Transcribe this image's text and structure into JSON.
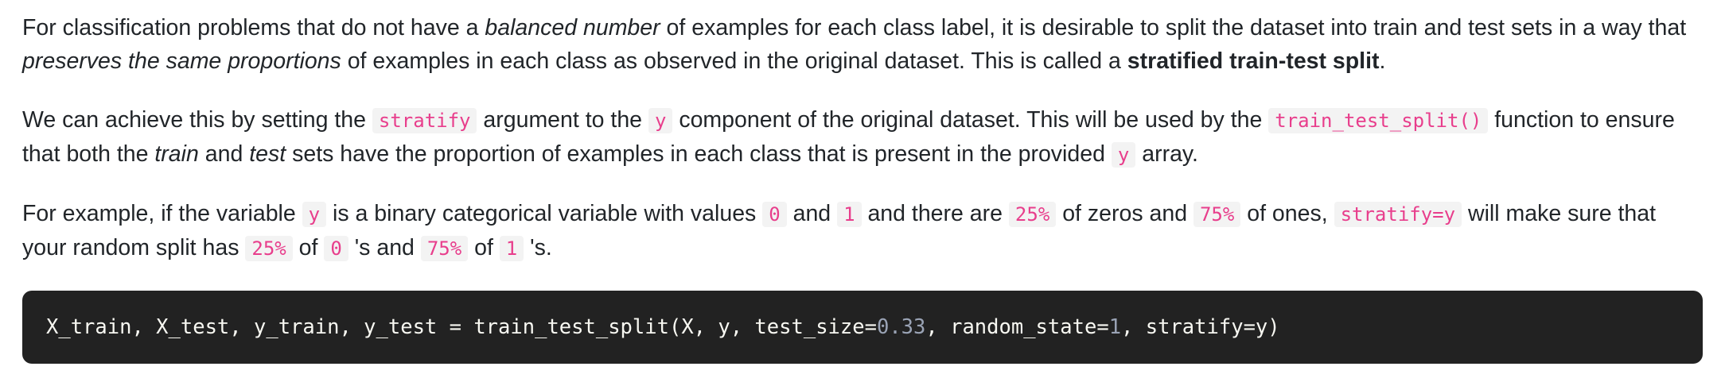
{
  "paragraph1": {
    "t1": "For classification problems that do not have a ",
    "em1": "balanced number",
    "t2": " of examples for each class label, it is desirable to split the dataset into train and test sets in a way that ",
    "em2": "preserves the same proportions",
    "t3": " of examples in each class as observed in the original dataset. This is called a ",
    "strong1": "stratified train-test split",
    "t4": "."
  },
  "paragraph2": {
    "t1": "We can achieve this by setting the ",
    "code1": "stratify",
    "t2": " argument to the ",
    "code2": "y",
    "t3": " component of the original dataset. This will be used by the ",
    "code3": "train_test_split()",
    "t4": " function to ensure that both the ",
    "em1": "train",
    "t5": " and ",
    "em2": "test",
    "t6": " sets have the proportion of examples in each class that is present in the provided ",
    "code4": "y",
    "t7": " array."
  },
  "paragraph3": {
    "t1": "For example, if the variable ",
    "code1": "y",
    "t2": " is a binary categorical variable with values ",
    "code2": "0",
    "t3": " and ",
    "code3": "1",
    "t4": " and there are ",
    "code4": "25%",
    "t5": " of zeros and ",
    "code5": "75%",
    "t6": " of ones, ",
    "code6": "stratify=y",
    "t7": " will make sure that your random split has ",
    "code7": "25%",
    "t8": " of ",
    "code8": "0",
    "t9": " 's and ",
    "code9": "75%",
    "t10": " of ",
    "code10": "1",
    "t11": " 's."
  },
  "code_block": {
    "part1": "X_train, X_test, y_train, y_test = train_test_split(X, y, test_size=",
    "num1": "0.33",
    "part2": ", random_state=",
    "num2": "1",
    "part3": ", stratify=y)"
  }
}
